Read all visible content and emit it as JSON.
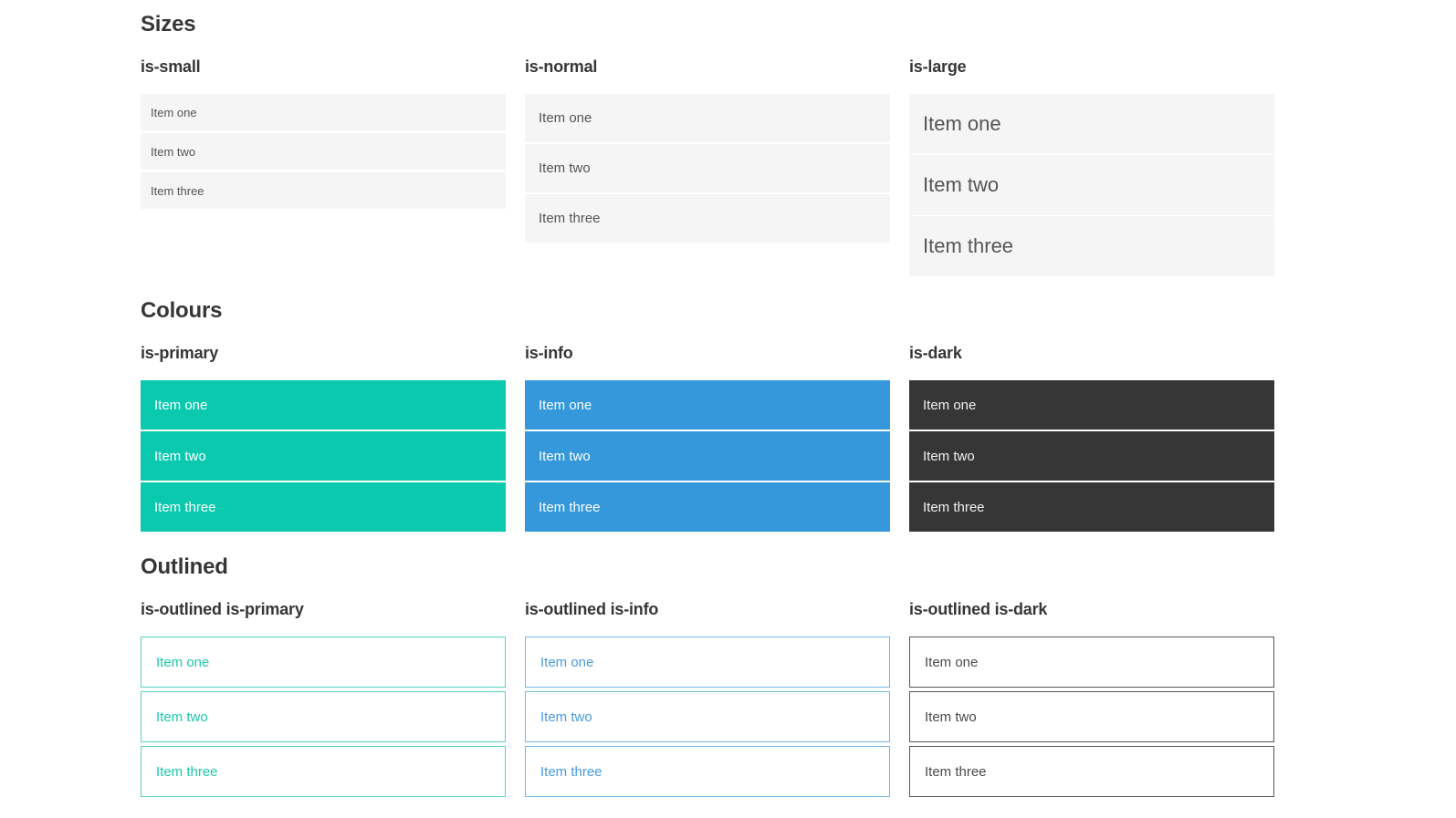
{
  "colors": {
    "heading": "#363636",
    "item_text_gray": "#555555",
    "neutral_bg": "#f5f5f5",
    "primary": "#0ac9ae",
    "info": "#3498db",
    "dark": "#363636",
    "outlined_primary_border": "#56d5bf",
    "outlined_primary_text": "#1fc8a9",
    "outlined_info_border": "#74b7e7",
    "outlined_info_text": "#4a9be0",
    "outlined_dark_border": "#54565a",
    "outlined_dark_text": "#4a4a4a"
  },
  "sections": [
    {
      "title": "Sizes",
      "groups": [
        {
          "label": "is-small",
          "items": [
            "Item one",
            "Item two",
            "Item three"
          ]
        },
        {
          "label": "is-normal",
          "items": [
            "Item one",
            "Item two",
            "Item three"
          ]
        },
        {
          "label": "is-large",
          "items": [
            "Item one",
            "Item two",
            "Item three"
          ]
        }
      ]
    },
    {
      "title": "Colours",
      "groups": [
        {
          "label": "is-primary",
          "items": [
            "Item one",
            "Item two",
            "Item three"
          ]
        },
        {
          "label": "is-info",
          "items": [
            "Item one",
            "Item two",
            "Item three"
          ]
        },
        {
          "label": "is-dark",
          "items": [
            "Item one",
            "Item two",
            "Item three"
          ]
        }
      ]
    },
    {
      "title": "Outlined",
      "groups": [
        {
          "label": "is-outlined is-primary",
          "items": [
            "Item one",
            "Item two",
            "Item three"
          ]
        },
        {
          "label": "is-outlined is-info",
          "items": [
            "Item one",
            "Item two",
            "Item three"
          ]
        },
        {
          "label": "is-outlined is-dark",
          "items": [
            "Item one",
            "Item two",
            "Item three"
          ]
        }
      ]
    }
  ]
}
